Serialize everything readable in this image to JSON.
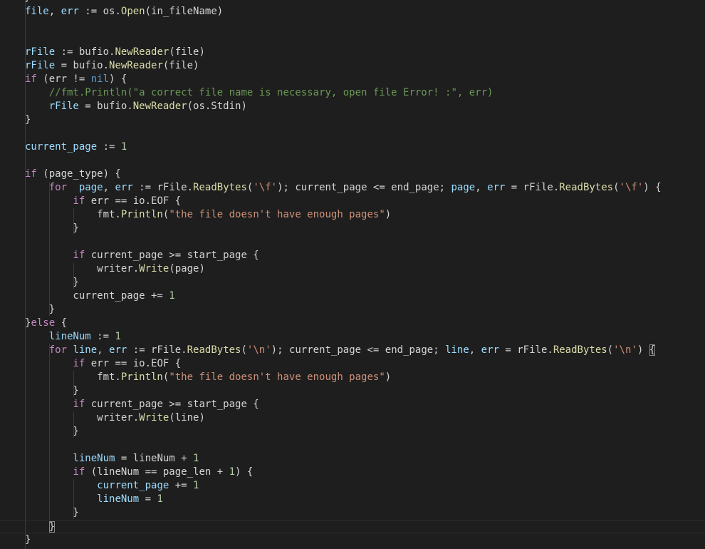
{
  "editor": {
    "top_fragment": "}",
    "lines": [
      [
        [
          "var",
          "file"
        ],
        [
          "plain",
          ", "
        ],
        [
          "var",
          "err"
        ],
        [
          "plain",
          " := os."
        ],
        [
          "fn",
          "Open"
        ],
        [
          "plain",
          "(in_fileName)"
        ]
      ],
      [],
      [],
      [
        [
          "var",
          "rFile"
        ],
        [
          "plain",
          " := bufio."
        ],
        [
          "fn",
          "NewReader"
        ],
        [
          "plain",
          "(file)"
        ]
      ],
      [
        [
          "var",
          "rFile"
        ],
        [
          "plain",
          " = bufio."
        ],
        [
          "fn",
          "NewReader"
        ],
        [
          "plain",
          "(file)"
        ]
      ],
      [
        [
          "kw",
          "if"
        ],
        [
          "plain",
          " (err != "
        ],
        [
          "const",
          "nil"
        ],
        [
          "plain",
          ") {"
        ]
      ],
      [
        [
          "plain",
          "    "
        ],
        [
          "cm",
          "//fmt.Println(\"a correct file name is necessary, open file Error! :\", err)"
        ]
      ],
      [
        [
          "plain",
          "    "
        ],
        [
          "var",
          "rFile"
        ],
        [
          "plain",
          " = bufio."
        ],
        [
          "fn",
          "NewReader"
        ],
        [
          "plain",
          "(os.Stdin)"
        ]
      ],
      [
        [
          "plain",
          "}"
        ]
      ],
      [],
      [
        [
          "var",
          "current_page"
        ],
        [
          "plain",
          " := "
        ],
        [
          "num",
          "1"
        ]
      ],
      [],
      [
        [
          "kw",
          "if"
        ],
        [
          "plain",
          " (page_type) {"
        ]
      ],
      [
        [
          "plain",
          "    "
        ],
        [
          "kw",
          "for"
        ],
        [
          "plain",
          "  "
        ],
        [
          "var",
          "page"
        ],
        [
          "plain",
          ", "
        ],
        [
          "var",
          "err"
        ],
        [
          "plain",
          " := rFile."
        ],
        [
          "fn",
          "ReadBytes"
        ],
        [
          "plain",
          "("
        ],
        [
          "str",
          "'\\f'"
        ],
        [
          "plain",
          "); current_page <= end_page; "
        ],
        [
          "var",
          "page"
        ],
        [
          "plain",
          ", "
        ],
        [
          "var",
          "err"
        ],
        [
          "plain",
          " = rFile."
        ],
        [
          "fn",
          "ReadBytes"
        ],
        [
          "plain",
          "("
        ],
        [
          "str",
          "'\\f'"
        ],
        [
          "plain",
          ") {"
        ]
      ],
      [
        [
          "plain",
          "        "
        ],
        [
          "kw",
          "if"
        ],
        [
          "plain",
          " err == io.EOF {"
        ]
      ],
      [
        [
          "plain",
          "            fmt."
        ],
        [
          "fn",
          "Println"
        ],
        [
          "plain",
          "("
        ],
        [
          "str",
          "\"the file doesn't have enough pages\""
        ],
        [
          "plain",
          ")"
        ]
      ],
      [
        [
          "plain",
          "        }"
        ]
      ],
      [],
      [
        [
          "plain",
          "        "
        ],
        [
          "kw",
          "if"
        ],
        [
          "plain",
          " current_page >= start_page {"
        ]
      ],
      [
        [
          "plain",
          "            writer."
        ],
        [
          "fn",
          "Write"
        ],
        [
          "plain",
          "(page)"
        ]
      ],
      [
        [
          "plain",
          "        }"
        ]
      ],
      [
        [
          "plain",
          "        current_page += "
        ],
        [
          "num",
          "1"
        ]
      ],
      [
        [
          "plain",
          "    }"
        ]
      ],
      [
        [
          "plain",
          "}"
        ],
        [
          "kw",
          "else"
        ],
        [
          "plain",
          " {"
        ]
      ],
      [
        [
          "plain",
          "    "
        ],
        [
          "var",
          "lineNum"
        ],
        [
          "plain",
          " := "
        ],
        [
          "num",
          "1"
        ]
      ],
      [
        [
          "plain",
          "    "
        ],
        [
          "kw",
          "for"
        ],
        [
          "plain",
          " "
        ],
        [
          "var",
          "line"
        ],
        [
          "plain",
          ", "
        ],
        [
          "var",
          "err"
        ],
        [
          "plain",
          " := rFile."
        ],
        [
          "fn",
          "ReadBytes"
        ],
        [
          "plain",
          "("
        ],
        [
          "str",
          "'\\n'"
        ],
        [
          "plain",
          "); current_page <= end_page; "
        ],
        [
          "var",
          "line"
        ],
        [
          "plain",
          ", "
        ],
        [
          "var",
          "err"
        ],
        [
          "plain",
          " = rFile."
        ],
        [
          "fn",
          "ReadBytes"
        ],
        [
          "plain",
          "("
        ],
        [
          "str",
          "'\\n'"
        ],
        [
          "plain",
          ") "
        ],
        [
          "match",
          "{"
        ]
      ],
      [
        [
          "plain",
          "        "
        ],
        [
          "kw",
          "if"
        ],
        [
          "plain",
          " err == io.EOF {"
        ]
      ],
      [
        [
          "plain",
          "            fmt."
        ],
        [
          "fn",
          "Println"
        ],
        [
          "plain",
          "("
        ],
        [
          "str",
          "\"the file doesn't have enough pages\""
        ],
        [
          "plain",
          ")"
        ]
      ],
      [
        [
          "plain",
          "        }"
        ]
      ],
      [
        [
          "plain",
          "        "
        ],
        [
          "kw",
          "if"
        ],
        [
          "plain",
          " current_page >= start_page {"
        ]
      ],
      [
        [
          "plain",
          "            writer."
        ],
        [
          "fn",
          "Write"
        ],
        [
          "plain",
          "(line)"
        ]
      ],
      [
        [
          "plain",
          "        }"
        ]
      ],
      [],
      [
        [
          "plain",
          "        "
        ],
        [
          "var",
          "lineNum"
        ],
        [
          "plain",
          " = lineNum + "
        ],
        [
          "num",
          "1"
        ]
      ],
      [
        [
          "plain",
          "        "
        ],
        [
          "kw",
          "if"
        ],
        [
          "plain",
          " (lineNum == page_len + "
        ],
        [
          "num",
          "1"
        ],
        [
          "plain",
          ") {"
        ]
      ],
      [
        [
          "plain",
          "            "
        ],
        [
          "var",
          "current_page"
        ],
        [
          "plain",
          " += "
        ],
        [
          "num",
          "1"
        ]
      ],
      [
        [
          "plain",
          "            "
        ],
        [
          "var",
          "lineNum"
        ],
        [
          "plain",
          " = "
        ],
        [
          "num",
          "1"
        ]
      ],
      [
        [
          "plain",
          "        }"
        ]
      ],
      [
        [
          "plain",
          "    "
        ],
        [
          "match",
          "}"
        ]
      ],
      [
        [
          "plain",
          "}"
        ]
      ]
    ],
    "colors": {
      "background": "#1e1e1e",
      "keyword": "#c586c0",
      "variable": "#9cdcfe",
      "function": "#dcdcaa",
      "string": "#ce9178",
      "number": "#b5cea8",
      "constant": "#569cd6",
      "comment": "#6a9955",
      "text": "#d4d4d4"
    }
  }
}
